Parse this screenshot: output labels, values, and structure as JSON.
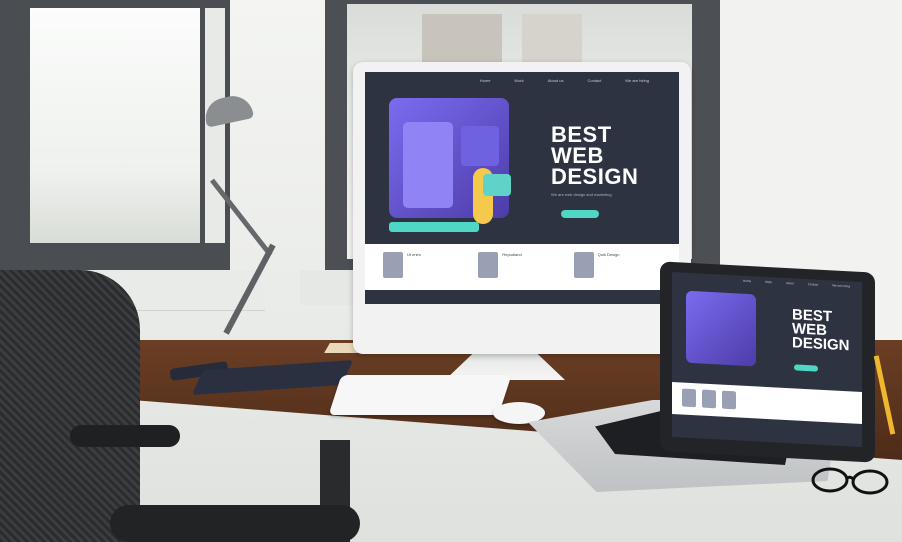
{
  "scene": {
    "colors": {
      "desk": "#5a3320",
      "screen_bg": "#2e3342",
      "accent_purple": "#7a6cf0",
      "accent_teal": "#4fd6c5",
      "figure_yellow": "#f5c94c"
    }
  },
  "monitor": {
    "nav": [
      "Home",
      "Work",
      "About us",
      "Contact",
      "We are hiring"
    ],
    "hero_title": "BEST WEB DESIGN",
    "hero_subtitle": "We are web design and marketing",
    "hero_button": "",
    "cards": [
      {
        "title": "Ut enim"
      },
      {
        "title": "Repudiand"
      },
      {
        "title": "Quis Design"
      }
    ]
  },
  "laptop": {
    "nav": [
      "Home",
      "Work",
      "About",
      "Contact",
      "We are hiring"
    ],
    "hero_title": "BEST WEB DESIGN"
  }
}
